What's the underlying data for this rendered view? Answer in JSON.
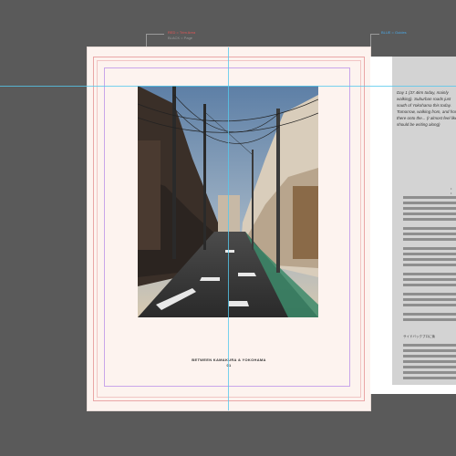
{
  "legend": {
    "red_label": "RED = Trim Area",
    "black_label": "BLACK = Page",
    "blue_label": "BLUE = Guides"
  },
  "left_page": {
    "photo": {
      "subject": "Narrow residential street lined with utility poles and wires at sunset"
    },
    "caption_line1": "BETWEEN KAMAKURA & YOKOHAMA",
    "caption_line2": "01"
  },
  "right_page": {
    "intro_text": "Day 1 (37.4km today, mainly walking). Suburban roads just south of Yokohama this today. Tomorrow, walking from, and from there onto the... (I almost feel like I should be writing along)",
    "subheading": "サイドバックプロに後",
    "dots": "• • • •"
  },
  "colors": {
    "background": "#5a5a5a",
    "page": "#fdf3ef",
    "trim_red": "#e9a6a6",
    "margin_purple": "#c9a6ea",
    "guide_blue": "#55c8ec"
  }
}
